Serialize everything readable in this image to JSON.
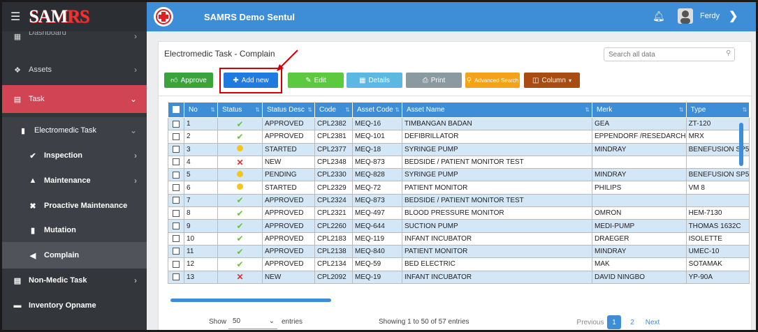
{
  "app": {
    "logo": "SAMRS",
    "title": "SAMRS Demo Sentul",
    "user": "Ferdy"
  },
  "sidebar": {
    "items": [
      {
        "label": "Dashboard",
        "icon": "dashboard-icon"
      },
      {
        "label": "Assets",
        "icon": "cubes-icon"
      },
      {
        "label": "Task",
        "icon": "clipboard-icon"
      },
      {
        "label": "Electromedic Task",
        "icon": "file-icon"
      },
      {
        "label": "Inspection",
        "icon": "check-icon"
      },
      {
        "label": "Maintenance",
        "icon": "ambulance-icon"
      },
      {
        "label": "Proactive Maintenance",
        "icon": "tools-icon"
      },
      {
        "label": "Mutation",
        "icon": "clipboard-icon"
      },
      {
        "label": "Complain",
        "icon": "megaphone-icon"
      },
      {
        "label": "Non-Medic Task",
        "icon": "clipboard-icon"
      },
      {
        "label": "Inventory Opname",
        "icon": "inbox-icon"
      }
    ]
  },
  "page": {
    "title": "Electromedic Task - Complain"
  },
  "search": {
    "placeholder": "Search all data"
  },
  "toolbar": {
    "approve": "Approve",
    "add_new": "Add new",
    "edit": "Edit",
    "details": "Details",
    "print": "Print",
    "advanced_search": "Advanced Search",
    "column": "Column"
  },
  "colors": {
    "primary": "#3d8ed6",
    "approve": "#3aa33c",
    "add": "#1f7be0",
    "edit": "#5cca3e",
    "details": "#5bb8e0",
    "print": "#8a9aa0",
    "advanced": "#f5a21b",
    "column": "#a94c12",
    "task": "#d04454"
  },
  "table": {
    "columns": [
      "No",
      "Status",
      "Status Desc",
      "Code",
      "Asset Code",
      "Asset Name",
      "Merk",
      "Type"
    ],
    "rows": [
      {
        "no": "1",
        "status": "ok",
        "desc": "APPROVED",
        "code": "CPL2382",
        "asset": "MEQ-16",
        "name": "TIMBANGAN BADAN",
        "merk": "GEA",
        "type": "ZT-120"
      },
      {
        "no": "2",
        "status": "ok",
        "desc": "APPROVED",
        "code": "CPL2381",
        "asset": "MEQ-101",
        "name": "DEFIBRILLATOR",
        "merk": "EPPENDORF /RESEDARCH",
        "type": "MRX"
      },
      {
        "no": "3",
        "status": "dot",
        "desc": "STARTED",
        "code": "CPL2377",
        "asset": "MEQ-18",
        "name": "SYRINGE PUMP",
        "merk": "MINDRAY",
        "type": "BENEFUSION SP5"
      },
      {
        "no": "4",
        "status": "x",
        "desc": "NEW",
        "code": "CPL2348",
        "asset": "MEQ-873",
        "name": "BEDSIDE / PATIENT MONITOR TEST",
        "merk": "",
        "type": ""
      },
      {
        "no": "5",
        "status": "dot",
        "desc": "PENDING",
        "code": "CPL2330",
        "asset": "MEQ-828",
        "name": "SYRINGE PUMP",
        "merk": "MINDRAY",
        "type": "BENEFUSION SP5"
      },
      {
        "no": "6",
        "status": "dot",
        "desc": "STARTED",
        "code": "CPL2329",
        "asset": "MEQ-72",
        "name": "PATIENT MONITOR",
        "merk": "PHILIPS",
        "type": "VM 8"
      },
      {
        "no": "7",
        "status": "ok",
        "desc": "APPROVED",
        "code": "CPL2324",
        "asset": "MEQ-873",
        "name": "BEDSIDE / PATIENT MONITOR TEST",
        "merk": "",
        "type": ""
      },
      {
        "no": "8",
        "status": "ok",
        "desc": "APPROVED",
        "code": "CPL2321",
        "asset": "MEQ-497",
        "name": "BLOOD PRESSURE MONITOR",
        "merk": "OMRON",
        "type": "HEM-7130"
      },
      {
        "no": "9",
        "status": "ok",
        "desc": "APPROVED",
        "code": "CPL2260",
        "asset": "MEQ-644",
        "name": "SUCTION PUMP",
        "merk": "MEDI-PUMP",
        "type": "THOMAS 1632C"
      },
      {
        "no": "10",
        "status": "ok",
        "desc": "APPROVED",
        "code": "CPL2183",
        "asset": "MEQ-119",
        "name": "INFANT INCUBATOR",
        "merk": "DRAEGER",
        "type": "ISOLETTE"
      },
      {
        "no": "11",
        "status": "ok",
        "desc": "APPROVED",
        "code": "CPL2138",
        "asset": "MEQ-840",
        "name": "PATIENT MONITOR",
        "merk": "MINDRAY",
        "type": "UMEC-10"
      },
      {
        "no": "12",
        "status": "ok",
        "desc": "APPROVED",
        "code": "CPL2134",
        "asset": "MEQ-59",
        "name": "BED ELECTRIC",
        "merk": "MAK",
        "type": "SOTAMAK"
      },
      {
        "no": "13",
        "status": "x",
        "desc": "NEW",
        "code": "CPL2092",
        "asset": "MEQ-19",
        "name": "INFANT INCUBATOR",
        "merk": "DAVID NINGBO",
        "type": "YP-90A"
      }
    ]
  },
  "footer": {
    "show": "Show",
    "entries_value": "50",
    "entries": "entries",
    "info": "Showing 1 to 50 of 57 entries",
    "previous": "Previous",
    "page1": "1",
    "page2": "2",
    "next": "Next"
  }
}
